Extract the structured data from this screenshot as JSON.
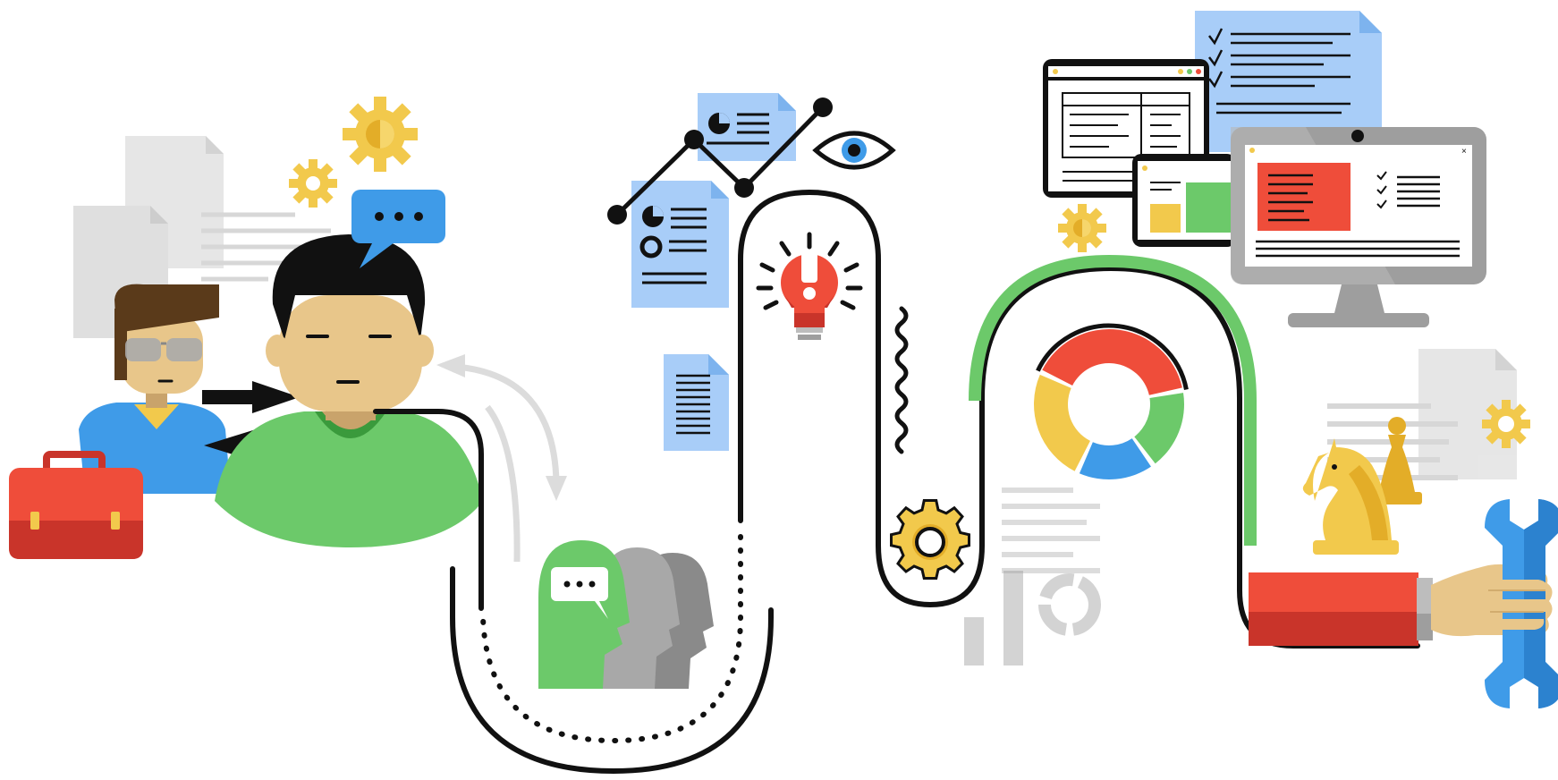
{
  "scene": {
    "colors": {
      "green": "#6cc96a",
      "dark_green": "#3a9a3c",
      "red": "#ef4d3a",
      "dark_red": "#c9342a",
      "yellow": "#f2c94c",
      "dark_yellow": "#e3ad28",
      "blue": "#3f9be8",
      "light_blue": "#a8cdf8",
      "skin": "#e8c68a",
      "hair_dark": "#111111",
      "hair_brown": "#5a3a1a",
      "gray": "#bdbdbd",
      "light_gray": "#e2e2e2",
      "black": "#111111"
    },
    "icons": [
      "person-icon",
      "worker-icon",
      "briefcase-icon",
      "speech-bubble-icon",
      "gear-icon",
      "document-icon",
      "line-chart-icon",
      "eye-icon",
      "lightbulb-icon",
      "heads-icon",
      "donut-chart-icon",
      "browser-window-icon",
      "monitor-icon",
      "checklist-icon",
      "chess-icon",
      "hand-wrench-icon",
      "bar-chart-icon"
    ],
    "donut_segments": [
      {
        "color": "#ef4d3a",
        "fraction": 0.4
      },
      {
        "color": "#6cc96a",
        "fraction": 0.18
      },
      {
        "color": "#3f9be8",
        "fraction": 0.17
      },
      {
        "color": "#f2c94c",
        "fraction": 0.25
      }
    ]
  }
}
